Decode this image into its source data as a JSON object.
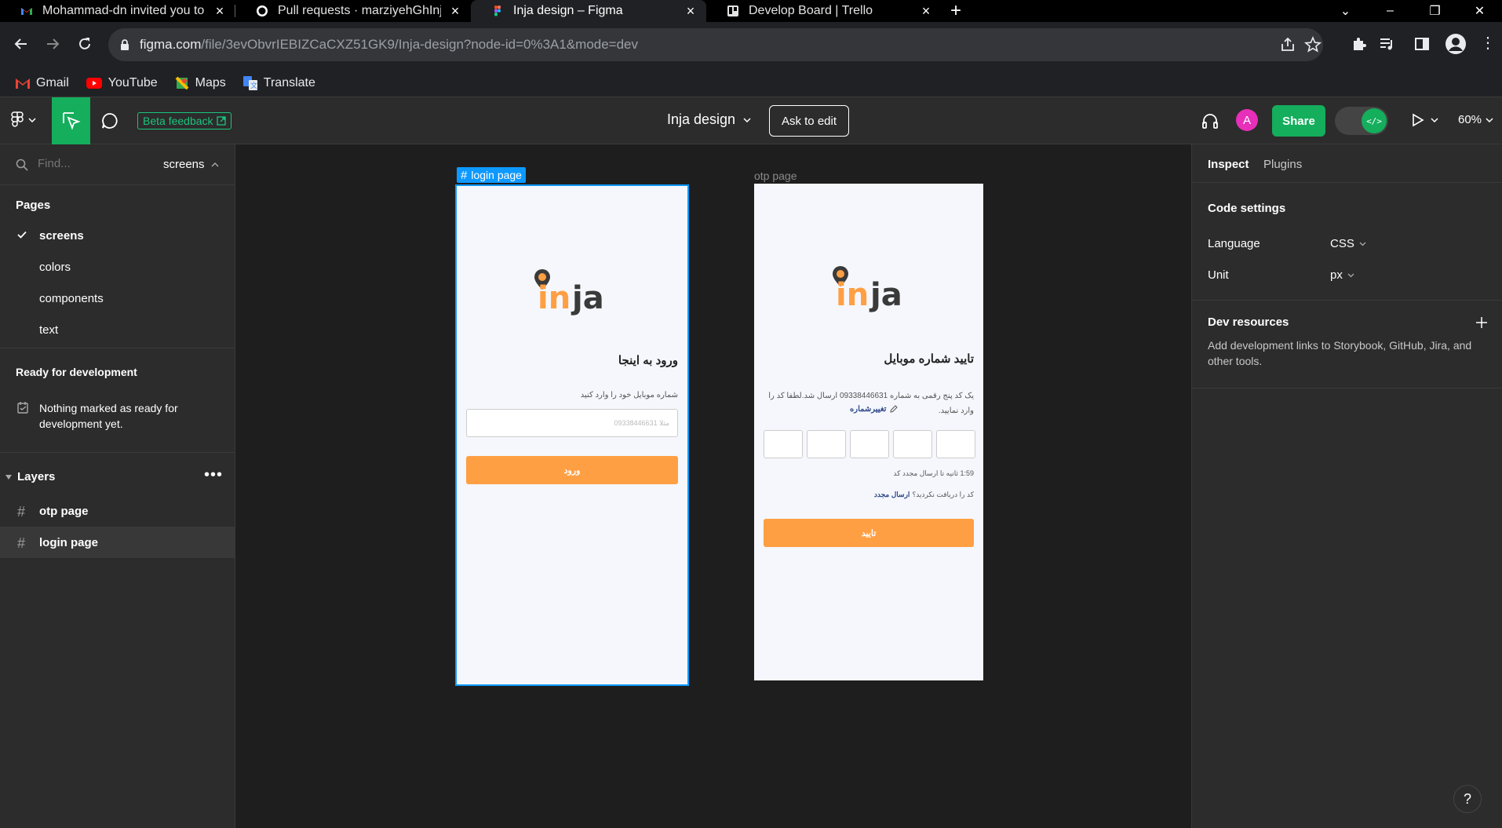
{
  "browser": {
    "tabs": [
      {
        "title": "Mohammad-dn invited you to M",
        "icon": "gmail-icon"
      },
      {
        "title": "Pull requests · marziyehGhInja/Fr",
        "icon": "github-icon"
      },
      {
        "title": "Inja design – Figma",
        "icon": "figma-icon",
        "active": true
      },
      {
        "title": "Develop Board | Trello",
        "icon": "trello-icon"
      }
    ],
    "url_host": "figma.com",
    "url_path": "/file/3evObvrIEBIZCaCXZ51GK9/Inja-design?node-id=0%3A1&mode=dev",
    "bookmarks": [
      "Gmail",
      "YouTube",
      "Maps",
      "Translate"
    ]
  },
  "figma": {
    "toolbar": {
      "beta_feedback": "Beta feedback",
      "file_name": "Inja design",
      "ask_to_edit": "Ask to edit",
      "avatar_initial": "A",
      "share": "Share",
      "dev_mode_glyph": "</>",
      "zoom": "60%"
    },
    "left_panel": {
      "find_placeholder": "Find...",
      "current_page": "screens",
      "pages_heading": "Pages",
      "pages": [
        "screens",
        "colors",
        "components",
        "text"
      ],
      "ready_heading": "Ready for development",
      "ready_empty": "Nothing marked as ready for development yet.",
      "layers_heading": "Layers",
      "layers": [
        "otp page",
        "login page"
      ]
    },
    "canvas": {
      "login": {
        "label": "login page",
        "logo": "inja",
        "heading": "ورود به اینجا",
        "instruction": "شماره موبایل خود را وارد کنید",
        "placeholder": "مثلا 09338446631",
        "button": "ورود"
      },
      "otp": {
        "label": "otp page",
        "logo": "inja",
        "heading": "تایید شماره موبایل",
        "message": "یک کد پنج رقمی به شماره 09338446631 ارسال شد.لطفا کد را وارد نمایید.",
        "change_number": "تغییرشماره",
        "timer": "1:59 ثانیه تا ارسال مجدد کد",
        "not_received": "کد را دریافت نکردید؟",
        "resend": "ارسال مجدد",
        "button": "تایید"
      }
    },
    "right_panel": {
      "tabs": [
        "Inspect",
        "Plugins"
      ],
      "code_settings": "Code settings",
      "language_label": "Language",
      "language_value": "CSS",
      "unit_label": "Unit",
      "unit_value": "px",
      "dev_resources": "Dev resources",
      "dev_resources_desc": "Add development links to Storybook, GitHub, Jira, and other tools."
    },
    "help": "?"
  },
  "colors": {
    "figma_blue": "#0d99ff",
    "share_green": "#14ae5c",
    "brand_orange": "#ff9f43",
    "avatar_pink": "#e72fb9"
  }
}
